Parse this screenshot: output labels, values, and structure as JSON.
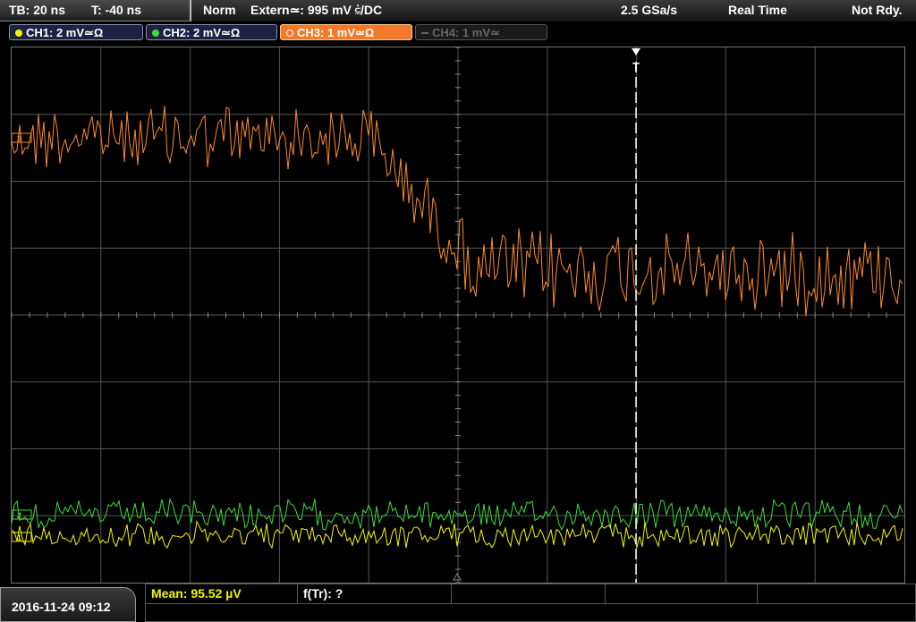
{
  "status_bar": {
    "timebase": "TB: 20 ns",
    "trigger_time": "T: -40 ns",
    "trigger_mode": "Norm",
    "trigger_source": "Extern≃: 995 mV ⫃/DC",
    "sample_rate": "2.5 GSa/s",
    "acquisition_mode": "Real Time",
    "trigger_state": "Not Rdy."
  },
  "channels": [
    {
      "label": "CH1: 2 mV≃Ω",
      "color": "#f5f500",
      "active": true
    },
    {
      "label": "CH2: 2 mV≃Ω",
      "color": "#3cdc3c",
      "active": true
    },
    {
      "label": "CH3: 1 mV≃Ω",
      "color": "#ff8a2a",
      "active": true,
      "selected": true
    },
    {
      "label": "CH4: 1 mV≃",
      "color": "#666666",
      "active": false
    }
  ],
  "markers": {
    "ch3": "3",
    "ch2": "2",
    "ch1": "1",
    "trigger": "T"
  },
  "bottom_bar": {
    "datetime": "2016-11-24 09:12",
    "measurement_1": "Mean: 95.52 µV",
    "measurement_2": "f(Tr): ?"
  },
  "colors": {
    "grid": "#555555",
    "ch1": "#f5f500",
    "ch2": "#3cdc3c",
    "ch3": "#ff8a2a",
    "trigger_line": "#ffffff",
    "meas_text": "#f5f500"
  }
}
